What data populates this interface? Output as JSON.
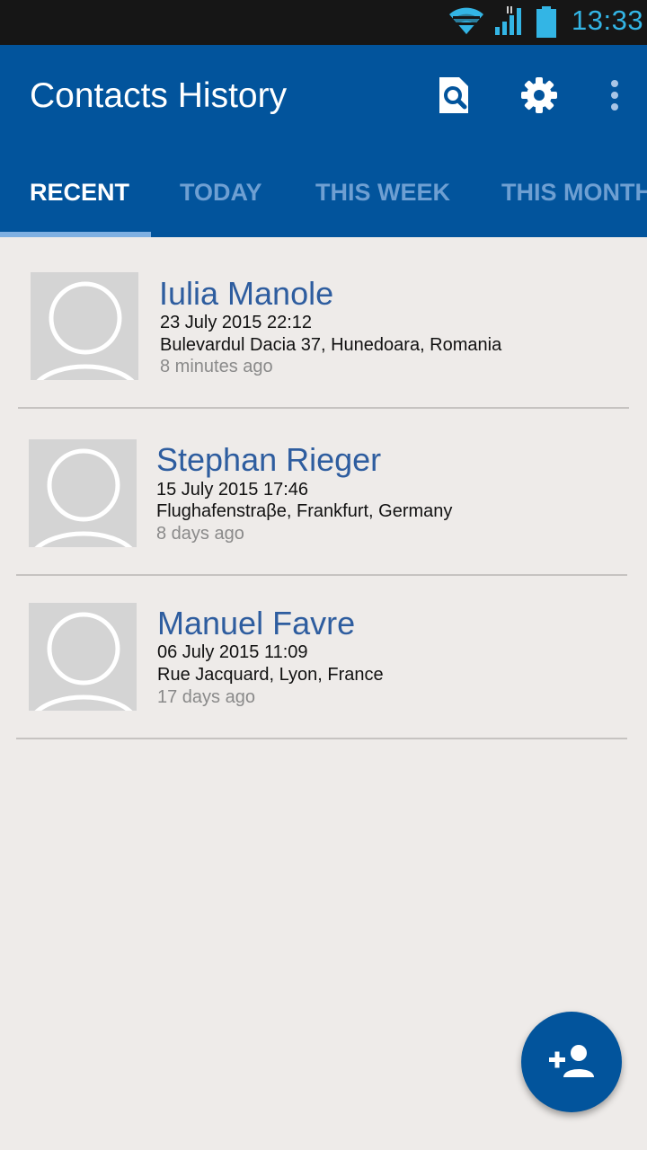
{
  "status_bar": {
    "time": "13:33",
    "icons": [
      "wifi-icon",
      "signal-icon",
      "battery-icon"
    ],
    "accent": "#33b5e5"
  },
  "app_bar": {
    "title": "Contacts History",
    "actions": [
      "search-document-icon",
      "gear-icon",
      "more-vert-icon"
    ],
    "color": "#02549c"
  },
  "tabs": [
    {
      "label": "RECENT",
      "active": true
    },
    {
      "label": "TODAY",
      "active": false
    },
    {
      "label": "THIS WEEK",
      "active": false
    },
    {
      "label": "THIS MONTH",
      "active": false
    }
  ],
  "contacts": [
    {
      "name": "Iulia Manole",
      "date": "23 July 2015 22:12",
      "place": "Bulevardul Dacia 37, Hunedoara, Romania",
      "ago": "8 minutes ago"
    },
    {
      "name": "Stephan Rieger",
      "date": "15 July 2015 17:46",
      "place": "Flughafenstraβe, Frankfurt, Germany",
      "ago": "8 days ago"
    },
    {
      "name": "Manuel Favre",
      "date": "06 July 2015 11:09",
      "place": "Rue Jacquard, Lyon, France",
      "ago": "17 days ago"
    }
  ],
  "fab": {
    "icon": "add-person-icon"
  }
}
